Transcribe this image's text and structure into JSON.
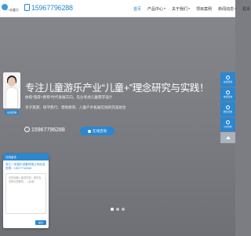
{
  "header": {
    "logo_text": "一米童乐",
    "phone": "15967796288",
    "nav": [
      {
        "label": "首页",
        "has_caret": false,
        "active": true
      },
      {
        "label": "产品中心",
        "has_caret": true,
        "active": false
      },
      {
        "label": "关于我们",
        "has_caret": true,
        "active": false
      },
      {
        "label": "项目案例",
        "has_caret": false,
        "active": false
      },
      {
        "label": "新闻动态",
        "has_caret": true,
        "active": false
      },
      {
        "label": "联系",
        "has_caret": false,
        "active": false
      }
    ]
  },
  "hero": {
    "headline": "专注儿童游乐产业“儿童+”理念研究与实践！",
    "sub1": "依照“旅游+教育”时代发展方向，先分考虑儿童需求设计",
    "sub2": "亲子旅游、研学旅行、营地教育、儿童户外拓展实践的完美组合",
    "phone": "15967796288",
    "consult_button": "在线咨询",
    "slides": 3,
    "active_slide": 1
  },
  "agent": {
    "button_label": "在线咨询"
  },
  "form": {
    "title": "在线留言",
    "company": "浙江一米童乐设备有限公司欢迎您拨：15977744448",
    "placeholder": "请在此输入留言内容，我们会尽快与您联系。（必填）",
    "submit": "提交"
  },
  "sidebar": {
    "items": [
      "在线咨询",
      "电话咨询",
      "微信咨询",
      "QQ咨询"
    ],
    "back_to_top": "返回顶部"
  }
}
